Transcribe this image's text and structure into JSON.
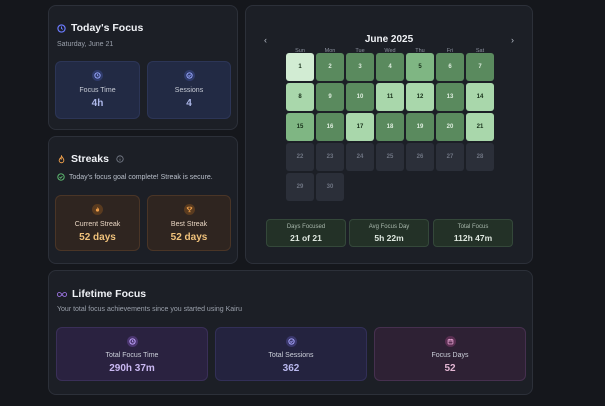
{
  "today": {
    "title": "Today's Focus",
    "date": "Saturday, June 21",
    "focus_time_label": "Focus Time",
    "focus_time_value": "4h",
    "sessions_label": "Sessions",
    "sessions_value": "4"
  },
  "streaks": {
    "title": "Streaks",
    "message": "Today's focus goal complete! Streak is secure.",
    "current_label": "Current Streak",
    "current_value": "52 days",
    "best_label": "Best Streak",
    "best_value": "52 days"
  },
  "calendar": {
    "month": "June 2025",
    "prev": "‹",
    "next": "›",
    "weekdays": [
      "Sun",
      "Mon",
      "Tue",
      "Wed",
      "Thu",
      "Fri",
      "Sat"
    ],
    "days": [
      {
        "d": "1",
        "level": 4
      },
      {
        "d": "2",
        "level": 1
      },
      {
        "d": "3",
        "level": 1
      },
      {
        "d": "4",
        "level": 1
      },
      {
        "d": "5",
        "level": 2
      },
      {
        "d": "6",
        "level": 1
      },
      {
        "d": "7",
        "level": 1
      },
      {
        "d": "8",
        "level": 3
      },
      {
        "d": "9",
        "level": 1
      },
      {
        "d": "10",
        "level": 1
      },
      {
        "d": "11",
        "level": 3
      },
      {
        "d": "12",
        "level": 3
      },
      {
        "d": "13",
        "level": 1
      },
      {
        "d": "14",
        "level": 3
      },
      {
        "d": "15",
        "level": 2
      },
      {
        "d": "16",
        "level": 1
      },
      {
        "d": "17",
        "level": 3
      },
      {
        "d": "18",
        "level": 1
      },
      {
        "d": "19",
        "level": 1
      },
      {
        "d": "20",
        "level": 1
      },
      {
        "d": "21",
        "level": 3
      },
      {
        "d": "22",
        "level": 0
      },
      {
        "d": "23",
        "level": 0
      },
      {
        "d": "24",
        "level": 0
      },
      {
        "d": "25",
        "level": 0
      },
      {
        "d": "26",
        "level": 0
      },
      {
        "d": "27",
        "level": 0
      },
      {
        "d": "28",
        "level": 0
      },
      {
        "d": "29",
        "level": 0
      },
      {
        "d": "30",
        "level": 0
      }
    ],
    "stats": [
      {
        "label": "Days Focused",
        "value": "21 of 21"
      },
      {
        "label": "Avg Focus Day",
        "value": "5h 22m"
      },
      {
        "label": "Total Focus",
        "value": "112h 47m"
      }
    ]
  },
  "lifetime": {
    "title": "Lifetime Focus",
    "subtitle": "Your total focus achievements since you started using Kairu",
    "total_time_label": "Total Focus Time",
    "total_time_value": "290h 37m",
    "total_sessions_label": "Total Sessions",
    "total_sessions_value": "362",
    "focus_days_label": "Focus Days",
    "focus_days_value": "52"
  },
  "colors": {
    "background": "#15171c",
    "card": "#1c1f26",
    "accent_blue": "#6b7bff",
    "streak_orange": "#f0a04b",
    "calendar_green": "#7fb683"
  },
  "icons": {
    "today": "clock-icon",
    "focus_time": "clock-icon",
    "sessions": "check-circle-icon",
    "streaks": "flame-icon",
    "info": "info-icon",
    "streak_ok": "check-circle-icon",
    "current": "flame-icon",
    "best": "trophy-icon",
    "lifetime": "infinity-icon",
    "total_time": "clock-icon",
    "total_sessions": "check-circle-icon",
    "focus_days": "calendar-icon"
  }
}
